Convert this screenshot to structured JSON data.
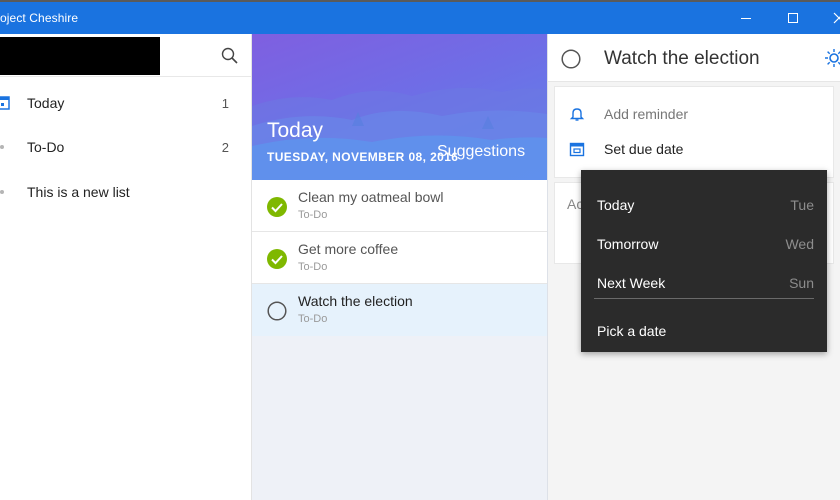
{
  "window": {
    "title": "oject Cheshire",
    "controls": [
      "minimize",
      "maximize",
      "close"
    ]
  },
  "sidebar": {
    "search_icon": "search-icon",
    "items": [
      {
        "label": "Today",
        "count": "1",
        "icon": "calendar-icon"
      },
      {
        "label": "To-Do",
        "count": "2",
        "icon": "dot-icon"
      },
      {
        "label": "This is a new list",
        "count": "",
        "icon": "dot-icon"
      }
    ]
  },
  "banner": {
    "title": "Today",
    "date": "TUESDAY, NOVEMBER 08, 2016",
    "suggestions": "Suggestions"
  },
  "tasks": [
    {
      "name": "Clean my oatmeal bowl",
      "list": "To-Do",
      "completed": true
    },
    {
      "name": "Get more coffee",
      "list": "To-Do",
      "completed": true
    },
    {
      "name": "Watch the election",
      "list": "To-Do",
      "completed": false,
      "selected": true
    }
  ],
  "detail": {
    "title": "Watch the election",
    "add_reminder": "Add reminder",
    "set_due_date": "Set due date",
    "note_placeholder": "Ac"
  },
  "due_menu": {
    "items": [
      {
        "label": "Today",
        "day": "Tue"
      },
      {
        "label": "Tomorrow",
        "day": "Wed"
      },
      {
        "label": "Next Week",
        "day": "Sun"
      }
    ],
    "pick": "Pick a date"
  },
  "colors": {
    "titlebar": "#1a73e0",
    "accent": "#1a73e0",
    "check": "#7fb800",
    "menu_bg": "#2b2b2b"
  }
}
